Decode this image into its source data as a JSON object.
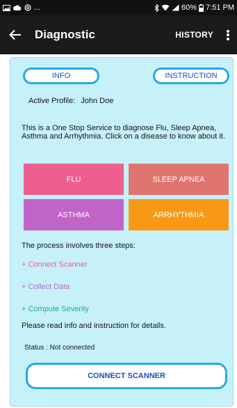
{
  "status_bar": {
    "left_glyph": "...",
    "time": "7:51 PM",
    "battery": "60%"
  },
  "app_bar": {
    "title": "Diagnostic",
    "history_label": "HISTORY"
  },
  "top_buttons": {
    "info": "INFO",
    "instruction": "INSTRUCTION"
  },
  "profile": {
    "label": "Active Profile:",
    "name": "John Doe"
  },
  "description": "This is a One Stop Service to diagnose Flu, Sleep Apnea, Asthma and Arrhythmia. Click on a disease to know about it.",
  "diseases": [
    {
      "label": "FLU",
      "color": "#ee5f8e"
    },
    {
      "label": "SLEEP APNEA",
      "color": "#e07570"
    },
    {
      "label": "ASTHMA",
      "color": "#c064c8"
    },
    {
      "label": "ARRHYTHMIA",
      "color": "#f79915"
    }
  ],
  "process": {
    "intro": "The process involves three steps:",
    "steps": [
      {
        "label": "+ Connect Scanner",
        "color": "#e15fa0"
      },
      {
        "label": "+ Collect Data",
        "color": "#b06ac8"
      },
      {
        "label": "+ Compute Severity",
        "color": "#22a894"
      }
    ],
    "note": "Please read info and instruction for details."
  },
  "status_text": "Status : Not connected",
  "connect_label": "CONNECT SCANNER",
  "colors": {
    "accent_border": "#26a8e6",
    "button_text": "#1c4dbd",
    "card_bg": "#c7f1f9",
    "appbar_bg": "#1b1b1b"
  }
}
